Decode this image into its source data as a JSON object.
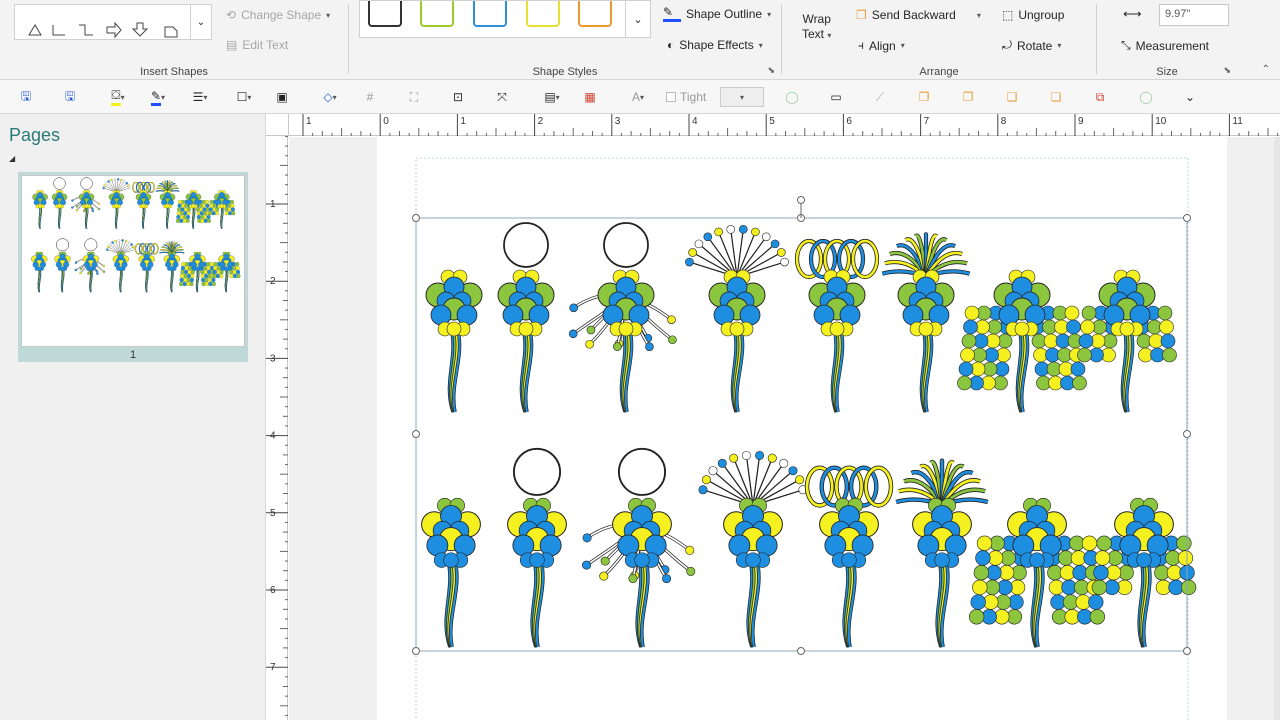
{
  "ribbon": {
    "insert_shapes": {
      "label": "Insert Shapes",
      "change_shape": "Change Shape",
      "edit_text": "Edit Text"
    },
    "shape_styles": {
      "label": "Shape Styles",
      "swatch_colors": [
        "#333333",
        "#9ccc2c",
        "#2e8fd6",
        "#e8e030",
        "#e89a30"
      ],
      "outline": "Shape Outline",
      "effects": "Shape Effects"
    },
    "arrange": {
      "label": "Arrange",
      "wrap_text_line1": "Wrap",
      "wrap_text_line2": "Text",
      "send_backward": "Send Backward",
      "ungroup": "Ungroup",
      "align": "Align",
      "rotate": "Rotate"
    },
    "size": {
      "label": "Size",
      "width_value": "9.97\"",
      "measurement": "Measurement"
    }
  },
  "toolbar": {
    "tight_label": "Tight"
  },
  "pages_panel": {
    "title": "Pages",
    "thumbnail_number": "1"
  },
  "ruler": {
    "horizontal_labels": [
      "1",
      "0",
      "1",
      "2",
      "3",
      "4",
      "5",
      "6",
      "7",
      "8",
      "9",
      "10",
      "11"
    ],
    "vertical_labels": [
      "1",
      "2",
      "3",
      "4",
      "5",
      "6",
      "7"
    ]
  },
  "colors": {
    "lime": "#8cc63f",
    "blue": "#1e8fe0",
    "yellow": "#f5f020",
    "outline": "#222222",
    "accent_teal": "#2b7a78"
  },
  "bouquets": {
    "top_row": [
      "round",
      "balloon-head",
      "balloon-head-spiky",
      "burst",
      "loops",
      "palm",
      "tassel",
      "tassel-small"
    ],
    "bottom_row": [
      "round",
      "balloon-head",
      "balloon-head-spiky",
      "burst",
      "loops",
      "palm",
      "tassel",
      "tassel-small"
    ]
  }
}
